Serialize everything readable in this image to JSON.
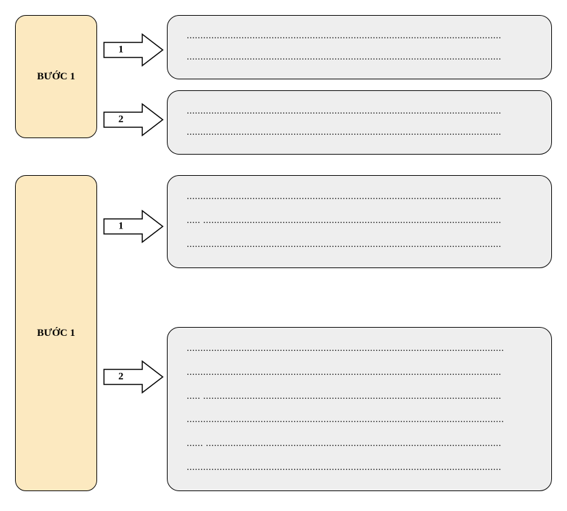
{
  "sections": [
    {
      "step_label": "BƯỚC 1",
      "arrows": [
        {
          "label": "1"
        },
        {
          "label": "2"
        }
      ],
      "boxes": [
        {
          "line_count": 2,
          "dotted": "..................................................................................................................."
        },
        {
          "line_count": 2,
          "dotted": "..................................................................................................................."
        }
      ]
    },
    {
      "step_label": "BƯỚC 1",
      "arrows": [
        {
          "label": "1"
        },
        {
          "label": "2"
        }
      ],
      "boxes": [
        {
          "line_count": 3,
          "lines": [
            "...................................................................................................................",
            ".....  .............................................................................................................",
            "..................................................................................................................."
          ]
        },
        {
          "line_count": 6,
          "lines": [
            "....................................................................................................................",
            "...................................................................................................................",
            ".....  .............................................................................................................",
            "....................................................................................................................",
            "......  ............................................................................................................",
            "..................................................................................................................."
          ]
        }
      ]
    }
  ]
}
